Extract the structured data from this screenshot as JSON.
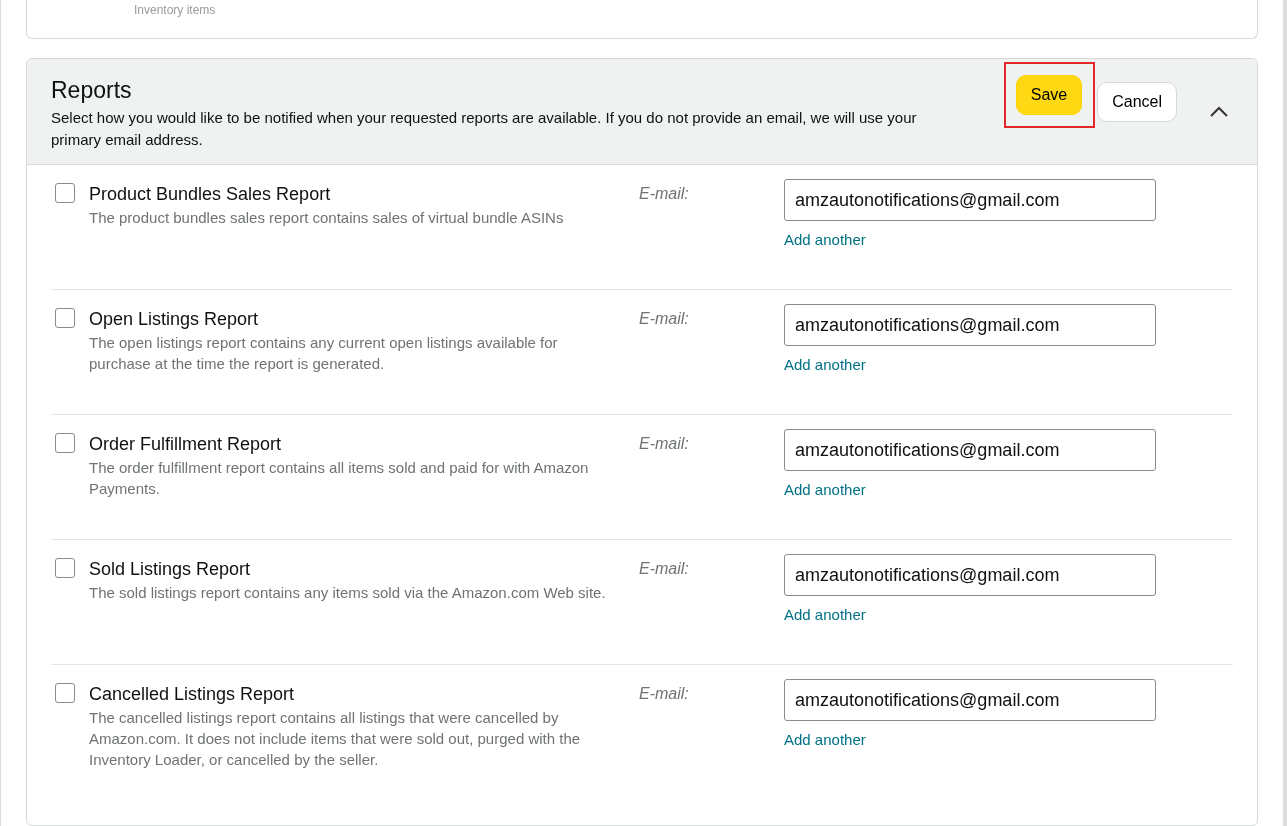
{
  "previous_section": {
    "text": "Inventory items"
  },
  "reports": {
    "title": "Reports",
    "description": "Select how you would like to be notified when your requested reports are available. If you do not provide an email, we will use your primary email address.",
    "buttons": [
      {
        "label": "Save",
        "kind": "primary",
        "highlighted": true
      },
      {
        "label": "Cancel",
        "kind": "secondary",
        "highlighted": false
      }
    ],
    "expanded": true,
    "items": [
      {
        "name": "Product Bundles Sales Report",
        "description": "The product bundles sales report contains sales of virtual bundle ASINs",
        "checked": false,
        "email_label": "E-mail:",
        "email": "amzautonotifications@gmail.com",
        "add_link": "Add another"
      },
      {
        "name": "Open Listings Report",
        "description": "The open listings report contains any current open listings available for purchase at the time the report is generated.",
        "checked": false,
        "email_label": "E-mail:",
        "email": "amzautonotifications@gmail.com",
        "add_link": "Add another"
      },
      {
        "name": "Order Fulfillment Report",
        "description": "The order fulfillment report contains all items sold and paid for with Amazon Payments.",
        "checked": false,
        "email_label": "E-mail:",
        "email": "amzautonotifications@gmail.com",
        "add_link": "Add another"
      },
      {
        "name": "Sold Listings Report",
        "description": "The sold listings report contains any items sold via the Amazon.com Web site.",
        "checked": false,
        "email_label": "E-mail:",
        "email": "amzautonotifications@gmail.com",
        "add_link": "Add another"
      },
      {
        "name": "Cancelled Listings Report",
        "description": "The cancelled listings report contains all listings that were cancelled by Amazon.com. It does not include items that were sold out, purged with the Inventory Loader, or cancelled by the seller.",
        "checked": false,
        "email_label": "E-mail:",
        "email": "amzautonotifications@gmail.com",
        "add_link": "Add another"
      }
    ]
  }
}
